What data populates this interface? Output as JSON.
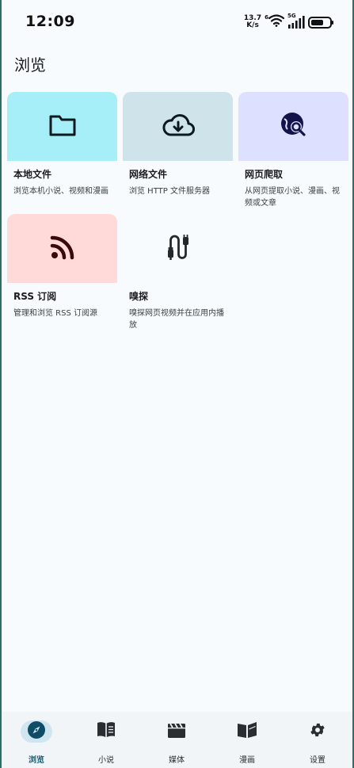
{
  "status_bar": {
    "time": "12:09",
    "net_speed_value": "13.7",
    "net_speed_unit": "K/s",
    "wifi_badge": "6",
    "cell_badge": "5G",
    "battery_level": 0.7
  },
  "page": {
    "title": "浏览"
  },
  "cards": [
    {
      "title": "本地文件",
      "desc": "浏览本机小说、视频和漫画",
      "icon": "folder-icon",
      "tile_color": "#a6eef8"
    },
    {
      "title": "网络文件",
      "desc": "浏览 HTTP 文件服务器",
      "icon": "cloud-download-icon",
      "tile_color": "#cfe4ea"
    },
    {
      "title": "网页爬取",
      "desc": "从网页提取小说、漫画、视频或文章",
      "icon": "web-search-icon",
      "tile_color": "#dde0ff"
    },
    {
      "title": "RSS 订阅",
      "desc": "管理和浏览 RSS 订阅源",
      "icon": "rss-icon",
      "tile_color": "#ffdad8"
    },
    {
      "title": "嗅探",
      "desc": "嗅探网页视频并在应用内播放",
      "icon": "cable-icon",
      "tile_color": "#f8fbfd"
    }
  ],
  "bottom_nav": [
    {
      "label": "浏览",
      "icon": "compass-icon",
      "active": true
    },
    {
      "label": "小说",
      "icon": "book-icon",
      "active": false
    },
    {
      "label": "媒体",
      "icon": "movie-icon",
      "active": false
    },
    {
      "label": "漫画",
      "icon": "comic-book-icon",
      "active": false
    },
    {
      "label": "设置",
      "icon": "gear-icon",
      "active": false
    }
  ],
  "colors": {
    "accent": "#0f5e7a",
    "active_pill": "#cfe6f1",
    "background": "#f8fbfd"
  }
}
